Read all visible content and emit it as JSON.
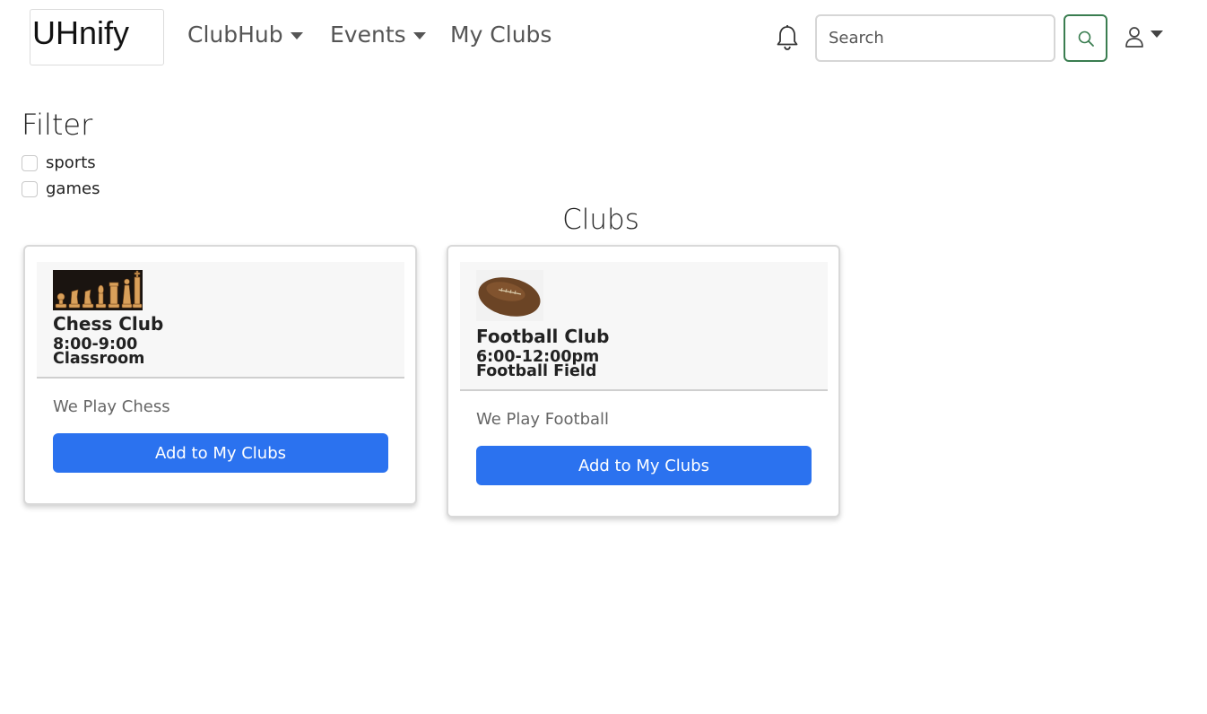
{
  "brand": {
    "logo_text": "UHnify"
  },
  "nav": {
    "items": [
      {
        "label": "ClubHub",
        "dropdown": true
      },
      {
        "label": "Events",
        "dropdown": true
      },
      {
        "label": "My Clubs",
        "dropdown": false
      }
    ]
  },
  "header": {
    "notification_icon": "bell-icon",
    "search": {
      "placeholder": "Search",
      "value": ""
    },
    "search_button_icon": "search-icon",
    "user_icon": "person-icon",
    "accent_color": "#3a7d50"
  },
  "filter": {
    "title": "Filter",
    "options": [
      {
        "label": "sports",
        "checked": false
      },
      {
        "label": "games",
        "checked": false
      }
    ]
  },
  "clubs": {
    "title": "Clubs",
    "cards": [
      {
        "name": "Chess Club",
        "time": "8:00-9:00",
        "location": "Classroom",
        "description": "We Play Chess",
        "button_label": "Add to My Clubs",
        "image": "chess-pieces-image"
      },
      {
        "name": "Football Club",
        "time": "6:00-12:00pm",
        "location": "Football Field",
        "description": "We Play Football",
        "button_label": "Add to My Clubs",
        "image": "football-image"
      }
    ],
    "button_color": "#2b72ef"
  }
}
